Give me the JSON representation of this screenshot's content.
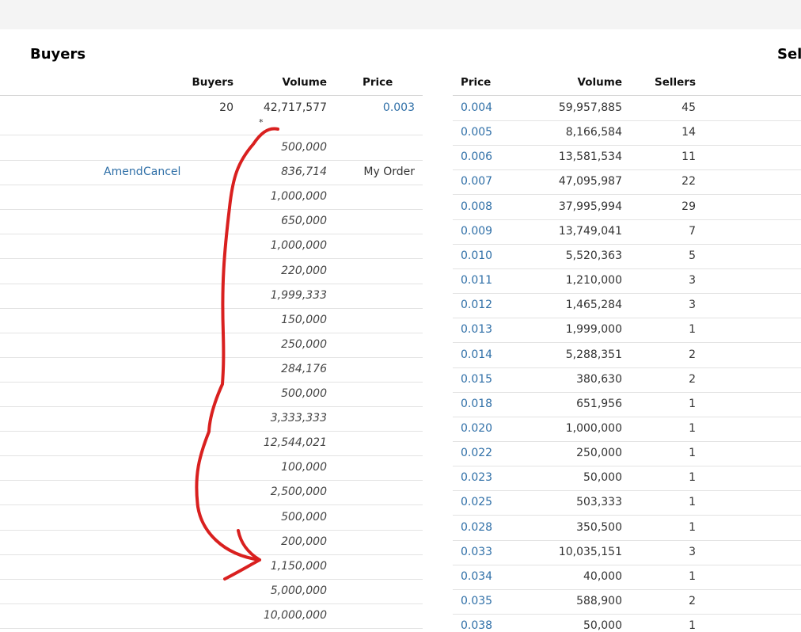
{
  "buyers": {
    "title": "Buyers",
    "headers": {
      "buyers": "Buyers",
      "volume": "Volume",
      "price": "Price"
    },
    "top_row": {
      "buyers": "20",
      "volume": "42,717,577",
      "price": "0.003",
      "marker": "*"
    },
    "order_rows": [
      {
        "volume": "500,000"
      },
      {
        "volume": "836,714",
        "amend": "Amend",
        "cancel": "Cancel",
        "note": "My Order"
      },
      {
        "volume": "1,000,000"
      },
      {
        "volume": "650,000"
      },
      {
        "volume": "1,000,000"
      },
      {
        "volume": "220,000"
      },
      {
        "volume": "1,999,333"
      },
      {
        "volume": "150,000"
      },
      {
        "volume": "250,000"
      },
      {
        "volume": "284,176"
      },
      {
        "volume": "500,000"
      },
      {
        "volume": "3,333,333"
      },
      {
        "volume": "12,544,021"
      },
      {
        "volume": "100,000"
      },
      {
        "volume": "2,500,000"
      },
      {
        "volume": "500,000"
      },
      {
        "volume": "200,000"
      },
      {
        "volume": "1,150,000"
      },
      {
        "volume": "5,000,000"
      },
      {
        "volume": "10,000,000"
      }
    ]
  },
  "sellers": {
    "title": "Sel",
    "headers": {
      "price": "Price",
      "volume": "Volume",
      "sellers": "Sellers"
    },
    "rows": [
      {
        "price": "0.004",
        "volume": "59,957,885",
        "sellers": "45"
      },
      {
        "price": "0.005",
        "volume": "8,166,584",
        "sellers": "14"
      },
      {
        "price": "0.006",
        "volume": "13,581,534",
        "sellers": "11"
      },
      {
        "price": "0.007",
        "volume": "47,095,987",
        "sellers": "22"
      },
      {
        "price": "0.008",
        "volume": "37,995,994",
        "sellers": "29"
      },
      {
        "price": "0.009",
        "volume": "13,749,041",
        "sellers": "7"
      },
      {
        "price": "0.010",
        "volume": "5,520,363",
        "sellers": "5"
      },
      {
        "price": "0.011",
        "volume": "1,210,000",
        "sellers": "3"
      },
      {
        "price": "0.012",
        "volume": "1,465,284",
        "sellers": "3"
      },
      {
        "price": "0.013",
        "volume": "1,999,000",
        "sellers": "1"
      },
      {
        "price": "0.014",
        "volume": "5,288,351",
        "sellers": "2"
      },
      {
        "price": "0.015",
        "volume": "380,630",
        "sellers": "2"
      },
      {
        "price": "0.018",
        "volume": "651,956",
        "sellers": "1"
      },
      {
        "price": "0.020",
        "volume": "1,000,000",
        "sellers": "1"
      },
      {
        "price": "0.022",
        "volume": "250,000",
        "sellers": "1"
      },
      {
        "price": "0.023",
        "volume": "50,000",
        "sellers": "1"
      },
      {
        "price": "0.025",
        "volume": "503,333",
        "sellers": "1"
      },
      {
        "price": "0.028",
        "volume": "350,500",
        "sellers": "1"
      },
      {
        "price": "0.033",
        "volume": "10,035,151",
        "sellers": "3"
      },
      {
        "price": "0.034",
        "volume": "40,000",
        "sellers": "1"
      },
      {
        "price": "0.035",
        "volume": "588,900",
        "sellers": "2"
      },
      {
        "price": "0.038",
        "volume": "50,000",
        "sellers": "1"
      }
    ]
  },
  "annotation": {
    "color": "#d9201f"
  },
  "colors": {
    "link": "#2f6fa7",
    "topbar": "#f4f4f4"
  }
}
